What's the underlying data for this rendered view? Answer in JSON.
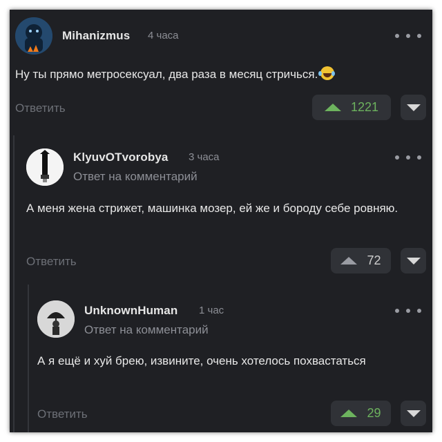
{
  "comments": [
    {
      "username": "Mihanizmus",
      "time": "4 часа",
      "text": "Ну ты прямо метросексуал, два раза в месяц стричься.",
      "emoji": "tears-of-joy-emoji",
      "reply_label": "Ответить",
      "votes": "1221"
    },
    {
      "username": "KlyuvOTvorobya",
      "time": "3 часа",
      "reply_note": "Ответ на комментарий",
      "text": "А меня жена стрижет, машинка мозер, ей же и бороду себе ровняю.",
      "reply_label": "Ответить",
      "votes": "72"
    },
    {
      "username": "UnknownHuman",
      "time": "1 час",
      "reply_note": "Ответ на комментарий",
      "text": "А я ещё и хуй брею, извините, очень хотелось похвастаться",
      "reply_label": "Ответить",
      "votes": "29"
    }
  ],
  "colors": {
    "background": "#1f2024",
    "upvote": "#6db35e",
    "button_bg": "#303237"
  }
}
